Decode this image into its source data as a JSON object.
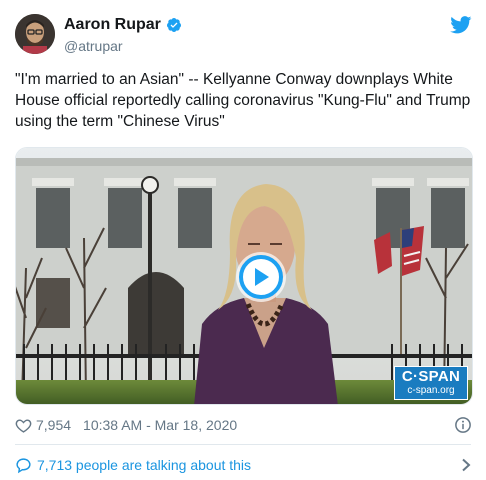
{
  "user": {
    "display_name": "Aaron Rupar",
    "handle": "@atrupar",
    "verified": true
  },
  "tweet": {
    "text": "\"I'm married to an Asian\" -- Kellyanne Conway downplays White House official reportedly calling coronavirus \"Kung-Flu\" and Trump using the term \"Chinese Virus\""
  },
  "media": {
    "type": "video",
    "watermark_name": "C·SPAN",
    "watermark_url": "c-span.org"
  },
  "meta": {
    "likes": "7,954",
    "timestamp": "10:38 AM - Mar 18, 2020"
  },
  "conversation": {
    "label": "7,713 people are talking about this"
  },
  "icons": {
    "brand": "twitter-bird-icon",
    "verified": "verified-badge-icon",
    "like": "heart-icon",
    "info": "info-icon",
    "conversation": "speech-bubble-icon",
    "chevron": "chevron-right-icon",
    "play": "play-icon"
  },
  "colors": {
    "brand_blue": "#1da1f2",
    "link_blue": "#1b95e0",
    "muted": "#657786",
    "text": "#14171a",
    "divider": "#e1e8ed",
    "cspan_blue": "#1a7cc0"
  }
}
